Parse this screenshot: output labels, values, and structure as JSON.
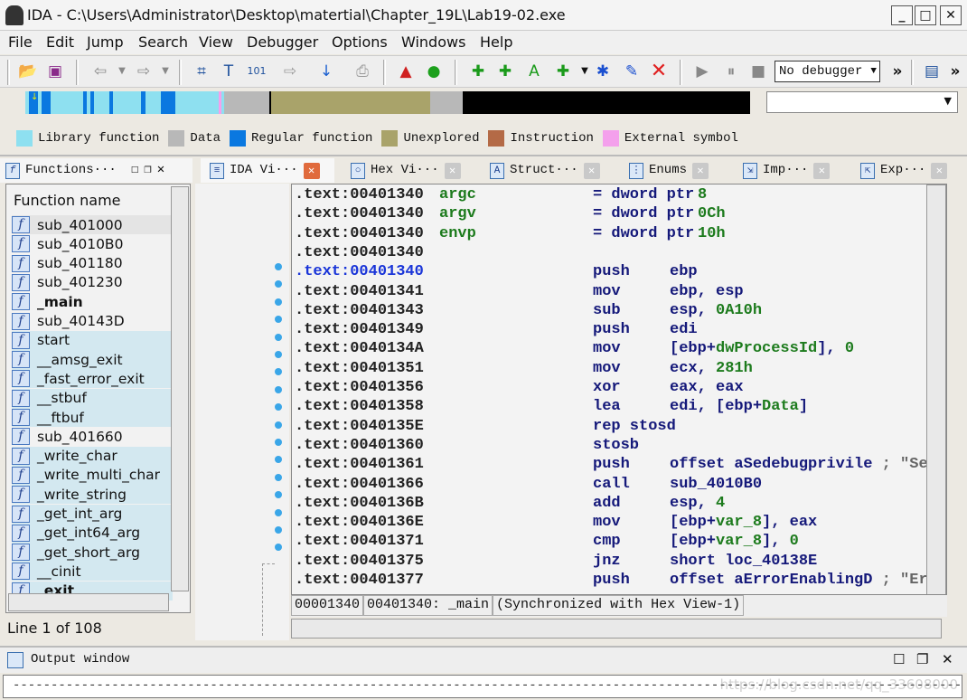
{
  "window": {
    "title": "IDA - C:\\Users\\Administrator\\Desktop\\matertial\\Chapter_19L\\Lab19-02.exe",
    "minimize": "_",
    "maximize": "□",
    "close": "✕"
  },
  "menu": [
    "File",
    "Edit",
    "Jump",
    "Search",
    "View",
    "Debugger",
    "Options",
    "Windows",
    "Help"
  ],
  "toolbar": {
    "debugger_select": "No debugger",
    "more": "»",
    "icons": [
      "open-icon",
      "save-icon",
      "back-icon",
      "forward-icon",
      "search-hex-icon",
      "search-text-icon",
      "search-binary-icon",
      "search-next-icon",
      "jump-icon",
      "print-icon",
      "breakpoint-icon",
      "run-icon",
      "add-code-icon",
      "add-data-icon",
      "add-string-icon",
      "add-struct-icon",
      "add-enum-icon",
      "edit-icon",
      "delete-icon",
      "play-icon",
      "pause-icon",
      "stop-icon"
    ]
  },
  "legend": [
    {
      "label": "Library function",
      "color": "#8ee0f0"
    },
    {
      "label": "Data",
      "color": "#b8b8b8"
    },
    {
      "label": "Regular function",
      "color": "#0a78e0"
    },
    {
      "label": "Unexplored",
      "color": "#a9a36a"
    },
    {
      "label": "Instruction",
      "color": "#b46a46"
    },
    {
      "label": "External symbol",
      "color": "#f4a0ec"
    }
  ],
  "tabs": [
    {
      "label": "Functions···"
    },
    {
      "label": "IDA Vi···",
      "active": true
    },
    {
      "label": "Hex Vi···"
    },
    {
      "label": "Struct···"
    },
    {
      "label": "Enums"
    },
    {
      "label": "Imp···"
    },
    {
      "label": "Exp···"
    }
  ],
  "functions": {
    "header": "Function name",
    "status": "Line 1 of 108",
    "items": [
      {
        "name": "sub_401000",
        "lib": false
      },
      {
        "name": "sub_4010B0",
        "lib": false
      },
      {
        "name": "sub_401180",
        "lib": false
      },
      {
        "name": "sub_401230",
        "lib": false
      },
      {
        "name": "_main",
        "lib": false,
        "bold": true
      },
      {
        "name": "sub_40143D",
        "lib": false
      },
      {
        "name": "start",
        "lib": true
      },
      {
        "name": "__amsg_exit",
        "lib": true
      },
      {
        "name": "_fast_error_exit",
        "lib": true
      },
      {
        "name": "__stbuf",
        "lib": true
      },
      {
        "name": "__ftbuf",
        "lib": true
      },
      {
        "name": "sub_401660",
        "lib": false
      },
      {
        "name": "_write_char",
        "lib": true
      },
      {
        "name": "_write_multi_char",
        "lib": true
      },
      {
        "name": "_write_string",
        "lib": true
      },
      {
        "name": "_get_int_arg",
        "lib": true
      },
      {
        "name": "_get_int64_arg",
        "lib": true
      },
      {
        "name": "_get_short_arg",
        "lib": true
      },
      {
        "name": "__cinit",
        "lib": true
      },
      {
        "name": "_exit",
        "lib": true,
        "bold": true
      }
    ]
  },
  "disasm": {
    "lines": [
      {
        "addr": ".text:00401340",
        "label": "argc",
        "mn": "= dword ptr",
        "ops": [
          [
            "8",
            "gr"
          ]
        ]
      },
      {
        "addr": ".text:00401340",
        "label": "argv",
        "mn": "= dword ptr",
        "ops": [
          [
            "0Ch",
            "gr"
          ]
        ]
      },
      {
        "addr": ".text:00401340",
        "label": "envp",
        "mn": "= dword ptr",
        "ops": [
          [
            "10h",
            "gr"
          ]
        ]
      },
      {
        "addr": ".text:00401340",
        "label": "",
        "mn": "",
        "ops": []
      },
      {
        "addr": ".text:00401340",
        "hl": true,
        "label": "",
        "mn": "push",
        "ops": [
          [
            "ebp",
            "op"
          ]
        ]
      },
      {
        "addr": ".text:00401341",
        "label": "",
        "mn": "mov",
        "ops": [
          [
            "ebp, esp",
            "op"
          ]
        ]
      },
      {
        "addr": ".text:00401343",
        "label": "",
        "mn": "sub",
        "ops": [
          [
            "esp, ",
            "op"
          ],
          [
            "0A10h",
            "gr"
          ]
        ]
      },
      {
        "addr": ".text:00401349",
        "label": "",
        "mn": "push",
        "ops": [
          [
            "edi",
            "op"
          ]
        ]
      },
      {
        "addr": ".text:0040134A",
        "label": "",
        "mn": "mov",
        "ops": [
          [
            "[ebp+",
            "op"
          ],
          [
            "dwProcessId",
            "gr"
          ],
          [
            "], ",
            "op"
          ],
          [
            "0",
            "gr"
          ]
        ]
      },
      {
        "addr": ".text:00401351",
        "label": "",
        "mn": "mov",
        "ops": [
          [
            "ecx, ",
            "op"
          ],
          [
            "281h",
            "gr"
          ]
        ]
      },
      {
        "addr": ".text:00401356",
        "label": "",
        "mn": "xor",
        "ops": [
          [
            "eax, eax",
            "op"
          ]
        ]
      },
      {
        "addr": ".text:00401358",
        "label": "",
        "mn": "lea",
        "ops": [
          [
            "edi, [ebp+",
            "op"
          ],
          [
            "Data",
            "gr"
          ],
          [
            "]",
            "op"
          ]
        ]
      },
      {
        "addr": ".text:0040135E",
        "label": "",
        "mn": "rep stosd",
        "ops": []
      },
      {
        "addr": ".text:00401360",
        "label": "",
        "mn": "stosb",
        "ops": []
      },
      {
        "addr": ".text:00401361",
        "label": "",
        "mn": "push",
        "ops": [
          [
            "offset aSedebugprivile ",
            "op"
          ],
          [
            "; \"Se",
            "cm"
          ]
        ]
      },
      {
        "addr": ".text:00401366",
        "label": "",
        "mn": "call",
        "ops": [
          [
            "sub_4010B0",
            "op"
          ]
        ]
      },
      {
        "addr": ".text:0040136B",
        "label": "",
        "mn": "add",
        "ops": [
          [
            "esp, ",
            "op"
          ],
          [
            "4",
            "gr"
          ]
        ]
      },
      {
        "addr": ".text:0040136E",
        "label": "",
        "mn": "mov",
        "ops": [
          [
            "[ebp+",
            "op"
          ],
          [
            "var_8",
            "gr"
          ],
          [
            "], eax",
            "op"
          ]
        ]
      },
      {
        "addr": ".text:00401371",
        "label": "",
        "mn": "cmp",
        "ops": [
          [
            "[ebp+",
            "op"
          ],
          [
            "var_8",
            "gr"
          ],
          [
            "], ",
            "op"
          ],
          [
            "0",
            "gr"
          ]
        ]
      },
      {
        "addr": ".text:00401375",
        "label": "",
        "mn": "jnz",
        "ops": [
          [
            "short loc_40138E",
            "op"
          ]
        ]
      },
      {
        "addr": ".text:00401377",
        "label": "",
        "mn": "push",
        "ops": [
          [
            "offset aErrorEnablingD ",
            "op"
          ],
          [
            "; \"Er",
            "cm"
          ]
        ]
      }
    ],
    "status": [
      "00001340",
      "00401340: _main",
      "(Synchronized with Hex View-1)"
    ]
  },
  "output": {
    "title": "Output window",
    "line": "-----------------------------------------------------------------------------------------------------------------------------"
  },
  "watermark": "https://blog.csdn.net/qq_33608000"
}
